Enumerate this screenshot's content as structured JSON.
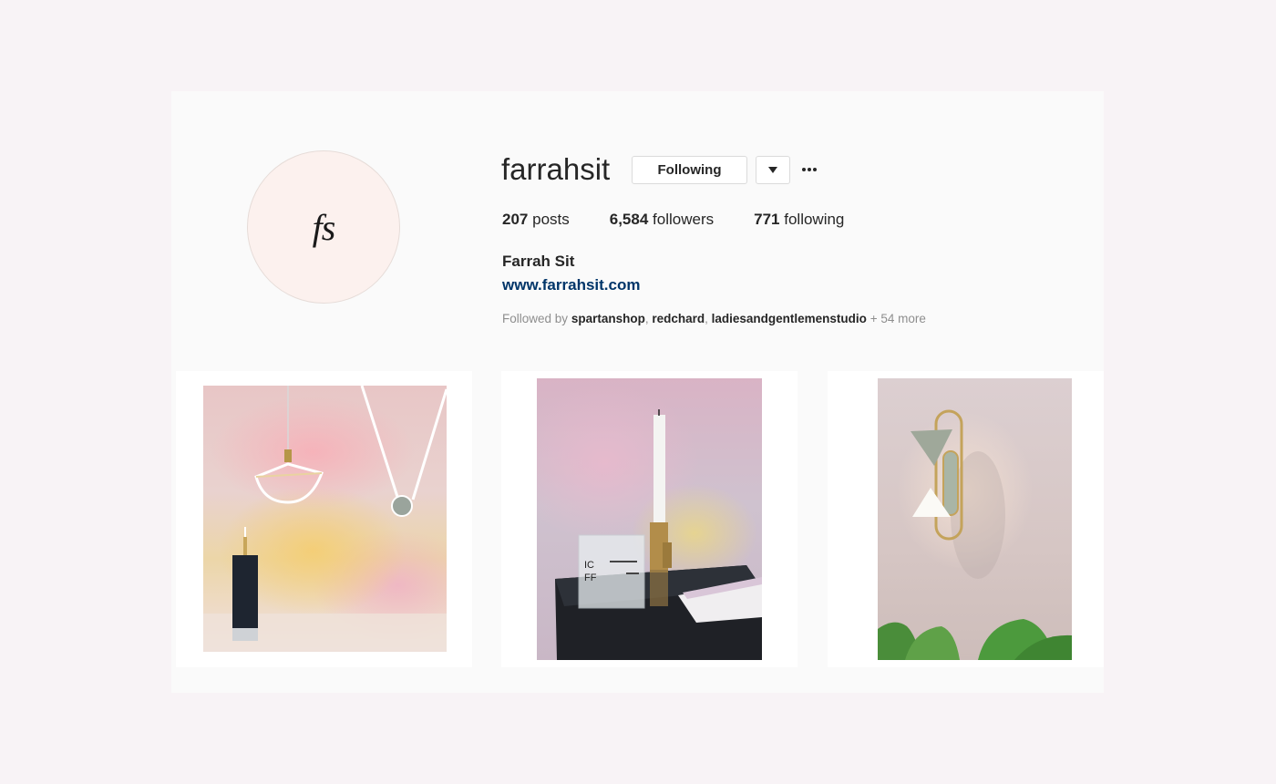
{
  "profile": {
    "username": "farrahsit",
    "avatar_monogram": "fs",
    "following_button": "Following",
    "full_name": "Farrah Sit",
    "website": "www.farrahsit.com",
    "stats": {
      "posts_count": "207",
      "posts_label": "posts",
      "followers_count": "6,584",
      "followers_label": "followers",
      "following_count": "771",
      "following_label": "following"
    },
    "followed_by": {
      "prefix": "Followed by",
      "users": [
        "spartanshop",
        "redchard",
        "ladiesandgentlemenstudio"
      ],
      "suffix": "+ 54 more"
    }
  },
  "icons": {
    "dropdown": "chevron-down-icon",
    "more": "more-options-icon"
  },
  "colors": {
    "background": "#f8f3f6",
    "card": "#fafafa",
    "link": "#003569",
    "muted_text": "#8e8e8e",
    "avatar_bg": "#fcf1ee"
  }
}
